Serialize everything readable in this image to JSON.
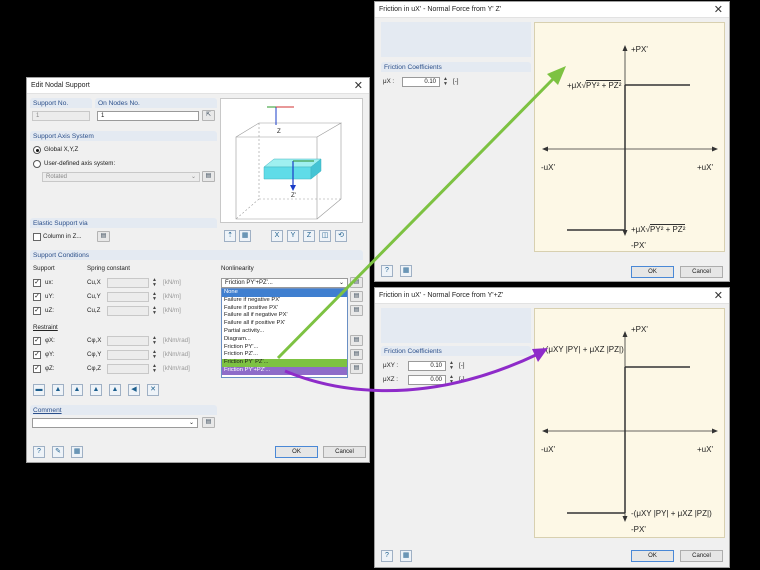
{
  "edit": {
    "title": "Edit Nodal Support",
    "support_no_label": "Support No.",
    "support_no_value": "1",
    "on_nodes_label": "On Nodes No.",
    "on_nodes_value": "1",
    "axis_section": "Support Axis System",
    "global_label": "Global X,Y,Z",
    "user_defined_label": "User-defined axis system:",
    "rotated_value": "Rotated",
    "elastic_section": "Elastic Support via",
    "column_label": "Column in Z...",
    "conditions_section": "Support Conditions",
    "support_col": "Support",
    "spring_col": "Spring constant",
    "nonlinearity_col": "Nonlinearity",
    "rows_support": [
      {
        "name": "ux:",
        "const": "Cu,X",
        "unit": "[kN/m]"
      },
      {
        "name": "uY:",
        "const": "Cu,Y",
        "unit": "[kN/m]"
      },
      {
        "name": "uZ:",
        "const": "Cu,Z",
        "unit": "[kN/m]"
      }
    ],
    "restraint_label": "Restraint",
    "rows_restraint": [
      {
        "name": "φX:",
        "const": "Cφ,X",
        "unit": "[kNm/rad]"
      },
      {
        "name": "φY:",
        "const": "Cφ,Y",
        "unit": "[kNm/rad]"
      },
      {
        "name": "φZ:",
        "const": "Cφ,Z",
        "unit": "[kNm/rad]"
      }
    ],
    "nonlin_selected": "Friction PY'+PZ'...",
    "dropdown_items": [
      "None",
      "Failure if negative PX'",
      "Failure if positive PX'",
      "Failure all if negative PX'",
      "Failure all if positive PX'",
      "Partial activity...",
      "Diagram...",
      "Friction PY'...",
      "Friction PZ'...",
      "Friction PY' PZ'...",
      "Friction PY'+PZ'..."
    ],
    "comment_label": "Comment",
    "ok": "OK",
    "cancel": "Cancel",
    "axis_label_z": "Z",
    "axis_label_z2": "Z'"
  },
  "fric1": {
    "title": "Friction in uX' - Normal Force from Y' Z'",
    "coeff_section": "Friction Coefficients",
    "mu_label": "μX :",
    "mu_value": "0.10",
    "unit": "[-]",
    "top_axis": "+PX'",
    "bottom_axis": "-PX'",
    "left_axis": "-uX'",
    "right_axis": "+uX'",
    "upper_formula_pre": "+μX",
    "upper_formula_rad": "PY² + PZ²",
    "lower_formula_pre": "+μX",
    "lower_formula_rad": "PY² + PZ²",
    "ok": "OK",
    "cancel": "Cancel"
  },
  "fric2": {
    "title": "Friction in uX' - Normal Force from Y'+Z'",
    "coeff_section": "Friction Coefficients",
    "mu1_label": "μXY :",
    "mu1_value": "0.10",
    "mu2_label": "μXZ :",
    "mu2_value": "0.00",
    "unit": "[-]",
    "top_axis": "+PX'",
    "bottom_axis": "-PX'",
    "left_axis": "-uX'",
    "right_axis": "+uX'",
    "upper_formula": "+(μXY |PY| + μXZ |PZ|)",
    "lower_formula": "-(μXY |PY| + μXZ |PZ|)",
    "ok": "OK",
    "cancel": "Cancel"
  },
  "colors": {
    "green_arrow": "#7dc242",
    "purple_arrow": "#8e2bc9",
    "chart_bg": "#fdf8e6",
    "section_bg": "#e4eaf2"
  }
}
